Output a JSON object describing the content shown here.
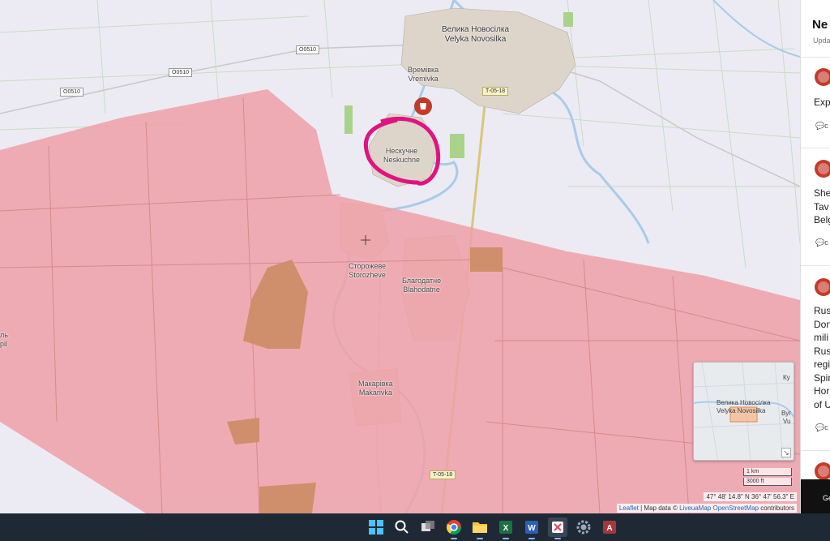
{
  "map": {
    "places": [
      {
        "id": "velyka-novosilka",
        "cyr": "Велика Новосілка",
        "lat": "Velyka Novosilka"
      },
      {
        "id": "vremivka",
        "cyr": "Времівка",
        "lat": "Vremivka"
      },
      {
        "id": "neskuchne",
        "cyr": "Нескучне",
        "lat": "Neskuchne"
      },
      {
        "id": "storozheve",
        "cyr": "Сторожеве",
        "lat": "Storozheve"
      },
      {
        "id": "blahodatne",
        "cyr": "Благодатне",
        "lat": "Blahodatne"
      },
      {
        "id": "makarivka",
        "cyr": "Макарівка",
        "lat": "Makarivka"
      }
    ],
    "edge_labels": [
      "ль",
      "pil"
    ],
    "roads": {
      "o0510": "O0510",
      "t0518": "T-05-18"
    },
    "colors": {
      "occupied_zone": "#f0a0a8",
      "annotation_circle": "#e0147e",
      "marker": "#c43a2a",
      "river": "#9cc4e8",
      "settlement": "#ddd6cb"
    },
    "minimap": {
      "cyr": "Велика Новосілка",
      "lat": "Velyka Novosilka",
      "edge_top": "Ку",
      "edge_mid1": "Вуг",
      "edge_mid2": "Vu"
    },
    "scale": {
      "km": "1 km",
      "ft": "3000 ft"
    },
    "coordinates": "47° 48' 14.8\" N 36° 47' 56.3\" E",
    "attribution": {
      "leaflet": "Leaflet",
      "sep": " | Map data © ",
      "liveuamap": "LiveuaMap",
      "osm": "OpenStreetMap",
      "tail": " contributors"
    }
  },
  "panel": {
    "title": "Ne",
    "subtitle": "Upda",
    "items": [
      {
        "lines": "Exp",
        "icon": "explosion-icon"
      },
      {
        "lines": "She\nTav\nBelg",
        "icon": "explosion-icon"
      },
      {
        "lines": "Rus\nDon\nmili\nRus\nregi\nSpir\nHor\nof U",
        "icon": "rifle-icon"
      }
    ],
    "comment_glyph": "c",
    "bottom_text": "Ge"
  },
  "taskbar": {
    "icons": [
      "windows-start-icon",
      "search-icon",
      "task-view-icon",
      "chrome-icon",
      "file-explorer-icon",
      "excel-icon",
      "word-icon",
      "snipping-tool-icon",
      "settings-icon",
      "access-icon"
    ]
  }
}
